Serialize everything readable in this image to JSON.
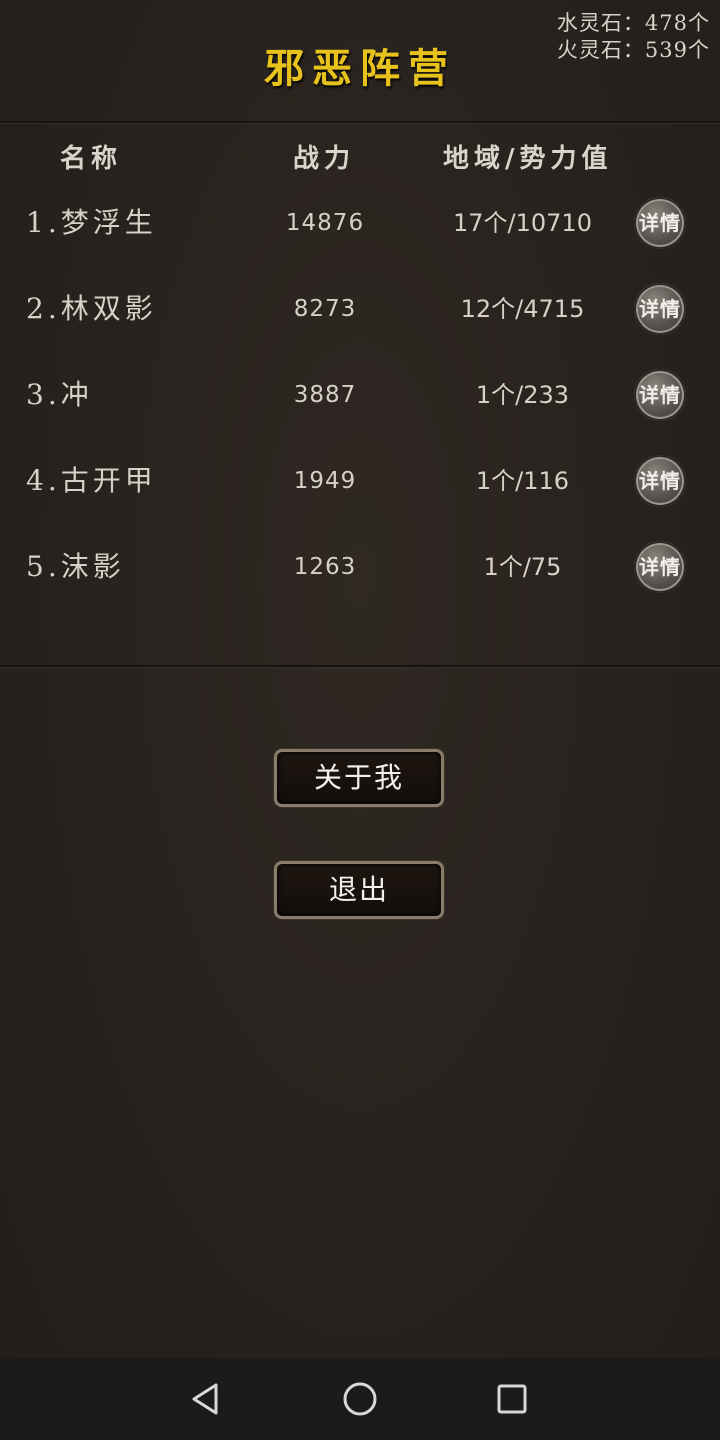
{
  "resources": {
    "water": "水灵石：478个",
    "fire": "火灵石：539个"
  },
  "title": "邪恶阵营",
  "table": {
    "headers": [
      "名称",
      "战力",
      "地域/势力值"
    ],
    "rows": [
      {
        "name": "1.梦浮生",
        "power": "14876",
        "region": "17个/10710",
        "detail": "详情"
      },
      {
        "name": "2.林双影",
        "power": "8273",
        "region": "12个/4715",
        "detail": "详情"
      },
      {
        "name": "3.冲",
        "power": "3887",
        "region": "1个/233",
        "detail": "详情"
      },
      {
        "name": "4.古开甲",
        "power": "1949",
        "region": "1个/116",
        "detail": "详情"
      },
      {
        "name": "5.沫影",
        "power": "1263",
        "region": "1个/75",
        "detail": "详情"
      }
    ]
  },
  "buttons": {
    "about": "关于我",
    "exit": "退出"
  },
  "navbar": {
    "icons": [
      "back-icon",
      "home-icon",
      "recent-apps-icon"
    ]
  },
  "colors": {
    "title": "#e7c21c",
    "background": "#2a2420",
    "text": "#d6d0c6"
  }
}
